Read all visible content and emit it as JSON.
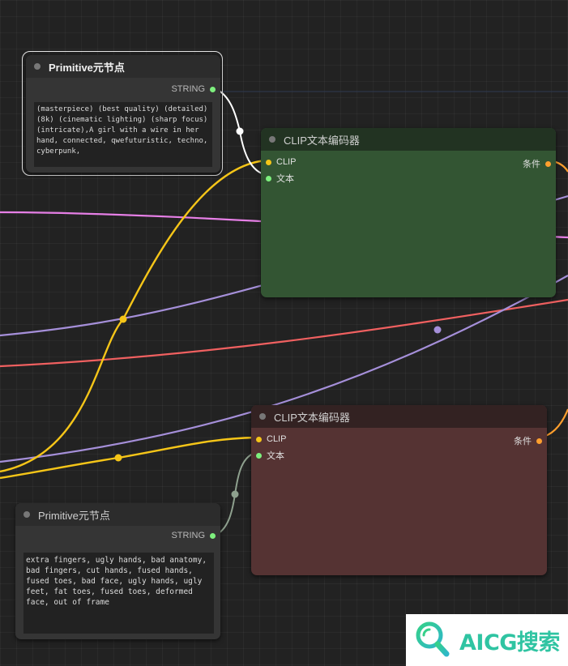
{
  "colors": {
    "clip_wire": "#f5c518",
    "string_wire": "#e8e8e8",
    "conditioning_wire": "#ff9f2e",
    "pink_wire": "#e67fe6",
    "purple_wire": "#a58fd9",
    "red_wire": "#f06060",
    "clip_node_bg": "#335533",
    "clip_neg_node_bg": "#553333",
    "string_slot": "#7ef07e",
    "clip_slot": "#f5c518",
    "cond_slot": "#ff9f2e",
    "brand": "#2fc4a2"
  },
  "nodes": {
    "primitive_positive": {
      "title": "Primitive元节点",
      "output_label": "STRING",
      "text": "(masterpiece) (best quality) (detailed) (8k) (cinematic lighting) (sharp focus) (intricate),A girl with a wire in her hand, connected, qwefuturistic, techno, cyberpunk,"
    },
    "clip_positive": {
      "title": "CLIP文本编码器",
      "input_clip": "CLIP",
      "input_text": "文本",
      "output_label": "条件"
    },
    "clip_negative": {
      "title": "CLIP文本编码器",
      "input_clip": "CLIP",
      "input_text": "文本",
      "output_label": "条件"
    },
    "primitive_negative": {
      "title": "Primitive元节点",
      "output_label": "STRING",
      "text": "extra fingers, ugly hands, bad anatomy, bad fingers, cut hands, fused hands, fused toes, bad face, ugly hands, ugly feet, fat toes, fused toes, deformed face, out of frame"
    }
  },
  "watermark": {
    "text": "AICG搜索",
    "icon": "search-magnifier-icon"
  }
}
